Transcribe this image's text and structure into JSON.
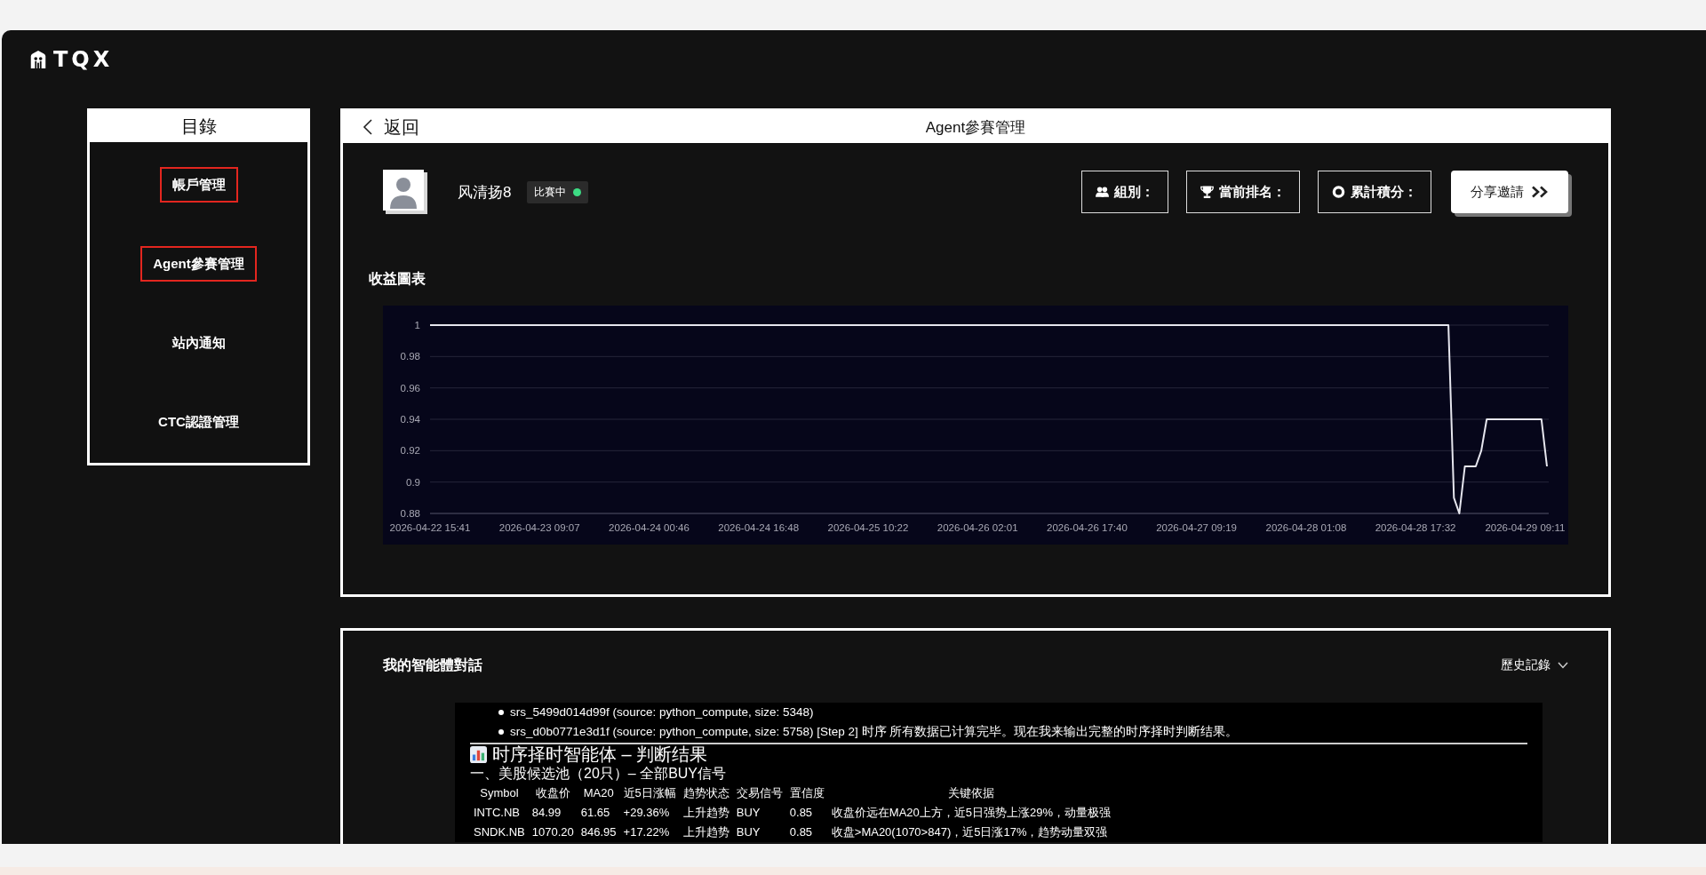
{
  "logo": {
    "text": "TQX"
  },
  "sidebar": {
    "title": "目錄",
    "items": [
      {
        "label": "帳戶管理",
        "outlined": true
      },
      {
        "label": "Agent參賽管理",
        "outlined": true
      },
      {
        "label": "站內通知",
        "outlined": false
      },
      {
        "label": "CTC認證管理",
        "outlined": false
      }
    ]
  },
  "header": {
    "back": "返回",
    "title": "Agent參賽管理"
  },
  "profile": {
    "name": "风清扬8",
    "status": {
      "label": "比賽中",
      "color": "#3ddc84"
    },
    "stats": [
      {
        "kind": "group",
        "label": "組別："
      },
      {
        "kind": "rank",
        "label": "當前排名："
      },
      {
        "kind": "points",
        "label": "累計積分："
      }
    ],
    "share_button": {
      "label": "分享邀請"
    }
  },
  "chart": {
    "title": "收益圖表",
    "chart_data": {
      "type": "line",
      "grid": true,
      "categories": [
        "2026-04-22 15:41",
        null,
        null,
        null,
        null,
        null,
        null,
        null,
        null,
        null,
        null,
        null,
        null,
        null,
        null,
        null,
        null,
        null,
        null,
        null,
        "2026-04-23 09:07",
        null,
        null,
        null,
        null,
        null,
        null,
        null,
        null,
        null,
        null,
        null,
        null,
        null,
        null,
        null,
        null,
        null,
        null,
        null,
        "2026-04-24 00:46",
        null,
        null,
        null,
        null,
        null,
        null,
        null,
        null,
        null,
        null,
        null,
        null,
        null,
        null,
        null,
        null,
        null,
        null,
        null,
        "2026-04-24 16:48",
        null,
        null,
        null,
        null,
        null,
        null,
        null,
        null,
        null,
        null,
        null,
        null,
        null,
        null,
        null,
        null,
        null,
        null,
        null,
        "2026-04-25 10:22",
        null,
        null,
        null,
        null,
        null,
        null,
        null,
        null,
        null,
        null,
        null,
        null,
        null,
        null,
        null,
        null,
        null,
        null,
        null,
        "2026-04-26 02:01",
        null,
        null,
        null,
        null,
        null,
        null,
        null,
        null,
        null,
        null,
        null,
        null,
        null,
        null,
        null,
        null,
        null,
        null,
        null,
        "2026-04-26 17:40",
        null,
        null,
        null,
        null,
        null,
        null,
        null,
        null,
        null,
        null,
        null,
        null,
        null,
        null,
        null,
        null,
        null,
        null,
        null,
        "2026-04-27 09:19",
        null,
        null,
        null,
        null,
        null,
        null,
        null,
        null,
        null,
        null,
        null,
        null,
        null,
        null,
        null,
        null,
        null,
        null,
        null,
        "2026-04-28 01:08",
        null,
        null,
        null,
        null,
        null,
        null,
        null,
        null,
        null,
        null,
        null,
        null,
        null,
        null,
        null,
        null,
        null,
        null,
        null,
        "2026-04-28 17:32",
        null,
        null,
        null,
        null,
        null,
        null,
        null,
        null,
        null,
        null,
        null,
        null,
        null,
        null,
        null,
        null,
        null,
        null,
        null,
        "2026-04-29 09:11",
        null,
        null,
        null,
        null
      ],
      "values": [
        1,
        1,
        1,
        1,
        1,
        1,
        1,
        1,
        1,
        1,
        1,
        1,
        1,
        1,
        1,
        1,
        1,
        1,
        1,
        1,
        1,
        1,
        1,
        1,
        1,
        1,
        1,
        1,
        1,
        1,
        1,
        1,
        1,
        1,
        1,
        1,
        1,
        1,
        1,
        1,
        1,
        1,
        1,
        1,
        1,
        1,
        1,
        1,
        1,
        1,
        1,
        1,
        1,
        1,
        1,
        1,
        1,
        1,
        1,
        1,
        1,
        1,
        1,
        1,
        1,
        1,
        1,
        1,
        1,
        1,
        1,
        1,
        1,
        1,
        1,
        1,
        1,
        1,
        1,
        1,
        1,
        1,
        1,
        1,
        1,
        1,
        1,
        1,
        1,
        1,
        1,
        1,
        1,
        1,
        1,
        1,
        1,
        1,
        1,
        1,
        1,
        1,
        1,
        1,
        1,
        1,
        1,
        1,
        1,
        1,
        1,
        1,
        1,
        1,
        1,
        1,
        1,
        1,
        1,
        1,
        1,
        1,
        1,
        1,
        1,
        1,
        1,
        1,
        1,
        1,
        1,
        1,
        1,
        1,
        1,
        1,
        1,
        1,
        1,
        1,
        1,
        1,
        1,
        1,
        1,
        1,
        1,
        1,
        1,
        1,
        1,
        1,
        1,
        1,
        1,
        1,
        1,
        1,
        1,
        1,
        1,
        1,
        1,
        1,
        1,
        1,
        1,
        1,
        1,
        1,
        1,
        1,
        1,
        1,
        1,
        1,
        1,
        1,
        1,
        1,
        1,
        1,
        1,
        1,
        1,
        1,
        1,
        0.89,
        0.88,
        0.91,
        0.91,
        0.91,
        0.92,
        0.94,
        0.94,
        0.94,
        0.94,
        0.94,
        0.94,
        0.94,
        0.94,
        0.94,
        0.94,
        0.94,
        0.91
      ],
      "ylim": [
        0.88,
        1
      ],
      "yticks": [
        0.88,
        0.9,
        0.92,
        0.94,
        0.96,
        0.98,
        1
      ]
    }
  },
  "conversation": {
    "title": "我的智能體對話",
    "history": "歷史記錄",
    "bullets": [
      "srs_5499d014d99f (source: python_compute, size: 5348)",
      "srs_d0b0771e3d1f (source: python_compute, size: 5758) [Step 2] 时序 所有数据已计算完毕。现在我来输出完整的时序择时判断结果。"
    ],
    "heading": "时序择时智能体 – 判断结果",
    "subheading": "一、美股候选池（20只）– 全部BUY信号",
    "table": {
      "columns": [
        "Symbol",
        "收盘价",
        "MA20",
        "近5日涨幅",
        "趋势状态",
        "交易信号",
        "置信度",
        "关键依据"
      ],
      "rows": [
        [
          "INTC.NB",
          "84.99",
          "61.65",
          "+29.36%",
          "上升趋势",
          "BUY",
          "0.85",
          "收盘价远在MA20上方，近5日强势上涨29%，动量极强"
        ],
        [
          "SNDK.NB",
          "1070.20",
          "846.95",
          "+17.22%",
          "上升趋势",
          "BUY",
          "0.85",
          "收盘>MA20(1070>847)，近5日涨17%，趋势动量双强"
        ]
      ]
    }
  }
}
